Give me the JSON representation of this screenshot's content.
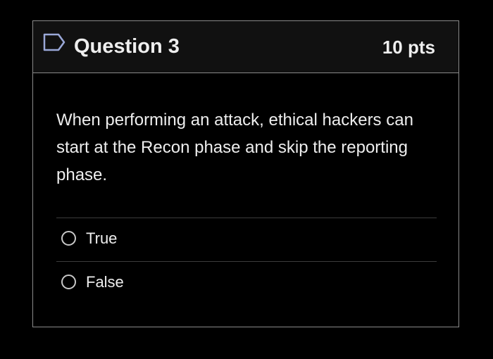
{
  "question": {
    "title": "Question 3",
    "points": "10 pts",
    "flag_icon": "flag-outline-icon",
    "text": "When performing an attack, ethical hackers can start at the Recon phase and skip the reporting phase."
  },
  "answers": [
    {
      "label": "True",
      "selected": false
    },
    {
      "label": "False",
      "selected": false
    }
  ]
}
